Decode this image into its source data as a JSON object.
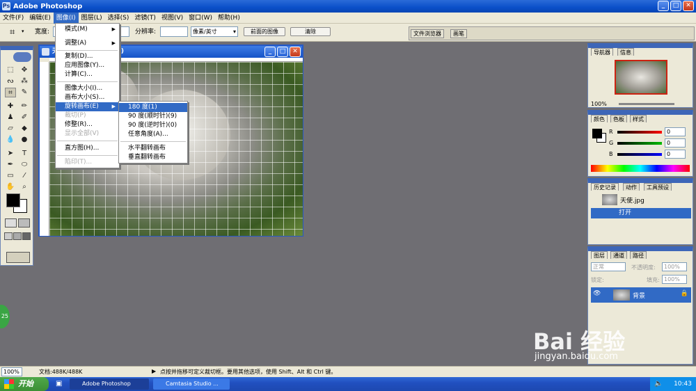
{
  "window": {
    "title": "Adobe Photoshop",
    "controls": [
      "_",
      "□",
      "✕"
    ]
  },
  "menubar": [
    {
      "label": "文件(F)"
    },
    {
      "label": "编辑(E)"
    },
    {
      "label": "图像(I)"
    },
    {
      "label": "图层(L)"
    },
    {
      "label": "选择(S)"
    },
    {
      "label": "滤镜(T)"
    },
    {
      "label": "视图(V)"
    },
    {
      "label": "窗口(W)"
    },
    {
      "label": "帮助(H)"
    }
  ],
  "options": {
    "width_label": "宽度:",
    "resolution_label": "分辨率:",
    "unit_value": "像素/英寸",
    "front_image_button": "前面的图像",
    "clear_button": "清除",
    "palette_well": [
      "文件浏览器",
      "画笔"
    ]
  },
  "document": {
    "title": "天使.jpg @ 100%(RGB)",
    "title_visible_start": "天",
    "title_visible_end": "B)"
  },
  "image_menu": [
    {
      "label": "模式(M)",
      "submenu": true
    },
    {
      "label": "调整(A)",
      "submenu": true
    },
    {
      "label": "复制(D)..."
    },
    {
      "label": "应用图像(Y)..."
    },
    {
      "label": "计算(C)..."
    },
    {
      "label": "图像大小(I)..."
    },
    {
      "label": "画布大小(S)..."
    },
    {
      "label": "旋转画布(E)",
      "submenu": true
    },
    {
      "label": "裁切(P)"
    },
    {
      "label": "修整(R)..."
    },
    {
      "label": "显示全部(V)"
    },
    {
      "label": "直方图(H)..."
    },
    {
      "label": "陷印(T)..."
    }
  ],
  "rotate_submenu": [
    {
      "label": "180 度(1)"
    },
    {
      "label": "90 度(顺时针)(9)"
    },
    {
      "label": "90 度(逆时针)(0)"
    },
    {
      "label": "任意角度(A)..."
    },
    {
      "label": "水平翻转画布"
    },
    {
      "label": "垂直翻转画布"
    }
  ],
  "navigator": {
    "tabs": [
      "导航器",
      "信息"
    ],
    "zoom": "100%"
  },
  "color_panel": {
    "tabs": [
      "颜色",
      "色板",
      "样式"
    ],
    "channels": [
      {
        "name": "R",
        "value": "0"
      },
      {
        "name": "G",
        "value": "0"
      },
      {
        "name": "B",
        "value": "0"
      }
    ]
  },
  "history_panel": {
    "tabs": [
      "历史记录",
      "动作",
      "工具预设"
    ],
    "snapshot": "天使.jpg",
    "steps": [
      "打开"
    ]
  },
  "layers_panel": {
    "tabs": [
      "图层",
      "通道",
      "路径"
    ],
    "blend_mode": "正常",
    "opacity_label": "不透明度:",
    "opacity": "100%",
    "lock_label": "锁定:",
    "fill_label": "填充:",
    "fill": "100%",
    "layer_name": "背景"
  },
  "status": {
    "zoom": "100%",
    "doc_info": "文档:488K/488K",
    "hint": "点按并拖移可定义裁切框。要用其他选项，使用 Shift、Alt 和 Ctrl 键。"
  },
  "taskbar": {
    "start": "开始",
    "tasks": [
      "Adobe Photoshop",
      "Camtasia Studio ..."
    ],
    "time": "10:43"
  },
  "watermark": {
    "brand": "Bai 经验",
    "url": "jingyan.baidu.com"
  },
  "badge": "25"
}
